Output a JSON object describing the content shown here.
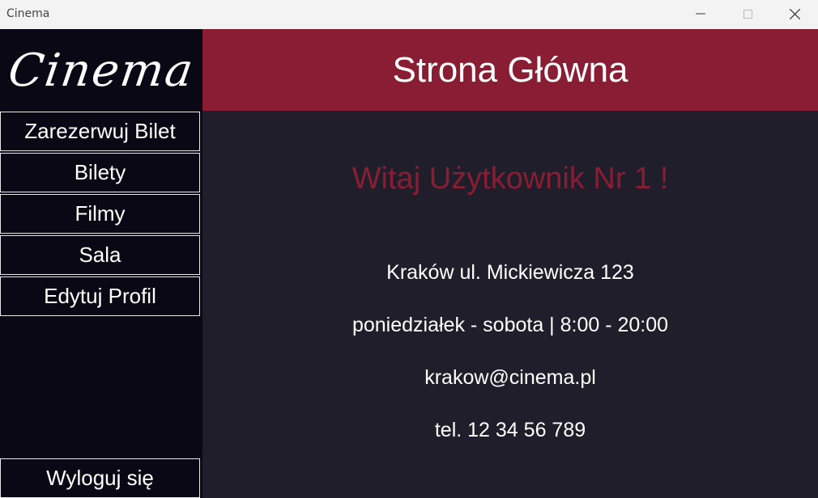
{
  "window": {
    "title": "Cinema"
  },
  "sidebar": {
    "logo": "Cinema",
    "items": [
      {
        "label": "Zarezerwuj Bilet"
      },
      {
        "label": "Bilety"
      },
      {
        "label": "Filmy"
      },
      {
        "label": "Sala"
      },
      {
        "label": "Edytuj Profil"
      }
    ],
    "logout_label": "Wyloguj się"
  },
  "header": {
    "title": "Strona Główna"
  },
  "main": {
    "welcome": "Witaj Użytkownik Nr 1 !",
    "address": "Kraków ul. Mickiewicza 123",
    "hours": "poniedziałek - sobota | 8:00 - 20:00",
    "email": "krakow@cinema.pl",
    "phone": "tel. 12 34 56 789"
  },
  "colors": {
    "accent": "#891d33",
    "sidebar_bg": "#0b0815",
    "content_bg": "#201e2b",
    "titlebar_bg": "#f3f3f3"
  }
}
